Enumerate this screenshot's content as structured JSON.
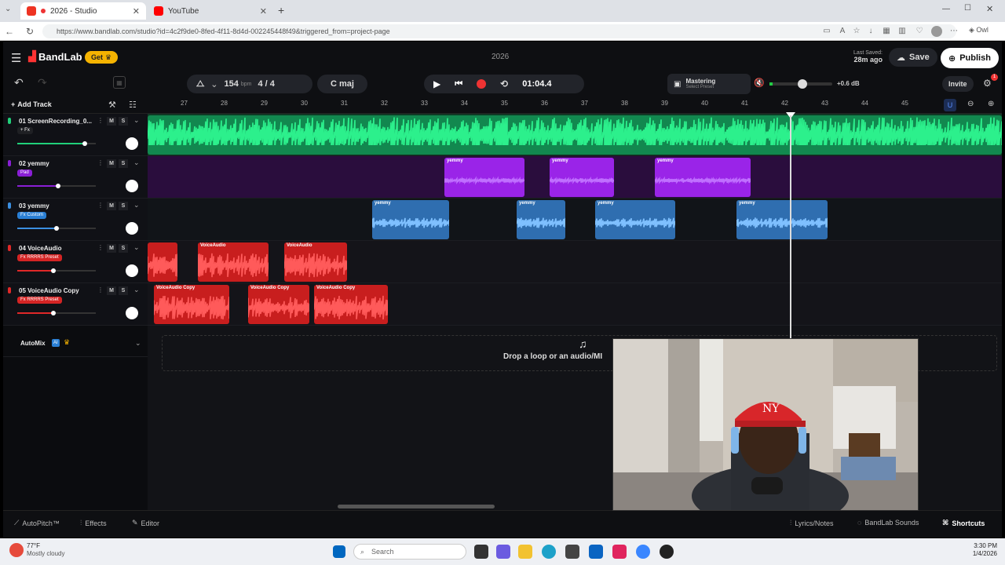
{
  "browser": {
    "tabs": [
      {
        "title": "2026 - Studio",
        "active": true
      },
      {
        "title": "YouTube",
        "active": false
      }
    ],
    "new_tab": "+",
    "url": "https://www.bandlab.com/studio?id=4c2f9de0-8fed-4f11-8d4d-002245448f49&triggered_from=project-page"
  },
  "app": {
    "logo": "BandLab",
    "get_badge": "Get",
    "project_title": "2026",
    "last_saved_label": "Last Saved:",
    "last_saved_value": "28m ago",
    "save_label": "Save",
    "publish_label": "Publish",
    "invite_label": "Invite",
    "notification_count": "1"
  },
  "toolbar": {
    "bpm": "154",
    "bpm_unit": "bpm",
    "time_signature": "4 / 4",
    "key": "C maj",
    "time": "01:04.4",
    "mastering_label": "Mastering",
    "mastering_preset": "Select Preset",
    "volume_db": "+0.6 dB"
  },
  "tracks_header": {
    "add_track_label": "Add Track"
  },
  "tracks": [
    {
      "name": "01 ScreenRecording_0...",
      "badge": "+ Fx",
      "badge_color": "#1f2024",
      "color": "#21d07a",
      "vol": 0.86
    },
    {
      "name": "02 yemmy",
      "badge": "Pad",
      "badge_color": "#8a1fd6",
      "color": "#8a1fd6",
      "vol": 0.52
    },
    {
      "name": "03 yemmy",
      "badge": "Fx Custom",
      "badge_color": "#2a7fd4",
      "color": "#3b8fe0",
      "vol": 0.5
    },
    {
      "name": "04 VoiceAudio",
      "badge": "Fx RRRRS Preset",
      "badge_color": "#d42424",
      "color": "#e02828",
      "vol": 0.46
    },
    {
      "name": "05 VoiceAudio Copy",
      "badge": "Fx RRRRS Preset",
      "badge_color": "#d42424",
      "color": "#e02828",
      "vol": 0.46
    }
  ],
  "track_buttons": {
    "mute": "M",
    "solo": "S"
  },
  "automix": {
    "label": "AutoMix",
    "badge": "AI"
  },
  "ruler": [
    "27",
    "28",
    "29",
    "30",
    "31",
    "32",
    "33",
    "34",
    "35",
    "36",
    "37",
    "38",
    "39",
    "40",
    "41",
    "42",
    "43",
    "44",
    "45"
  ],
  "clips": {
    "lane2": [
      "yemmy",
      "yemmy",
      "yemmy"
    ],
    "lane3": [
      "yemmy",
      "yemmy",
      "yemmy",
      "yemmy"
    ],
    "lane4": [
      "VoiceAudio",
      "VoiceAudio"
    ],
    "lane5": [
      "VoiceAudio Copy",
      "VoiceAudio Copy",
      "VoiceAudio Copy"
    ]
  },
  "dropzone": {
    "text": "Drop a loop or an audio/MI"
  },
  "bottombar": {
    "autopitch": "AutoPitch™",
    "effects": "Effects",
    "editor": "Editor",
    "lyrics": "Lyrics/Notes",
    "sounds": "BandLab Sounds",
    "shortcuts": "Shortcuts"
  },
  "taskbar": {
    "weather_temp": "77°F",
    "weather_desc": "Mostly cloudy",
    "search_placeholder": "Search",
    "clock_time": "3:30 PM",
    "clock_date": "1/4/2026"
  }
}
